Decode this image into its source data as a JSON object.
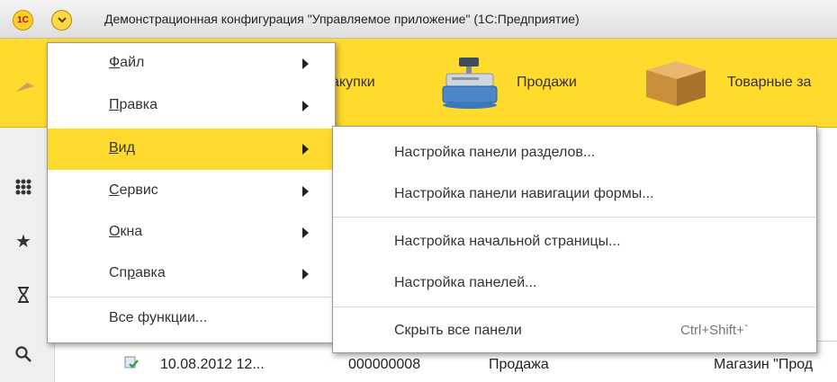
{
  "window": {
    "title": "Демонстрационная конфигурация \"Управляемое приложение\"  (1С:Предприятие)",
    "logo_text": "1С"
  },
  "sections": [
    {
      "label": "акупки",
      "icon": "purchases-icon"
    },
    {
      "label": "Продажи",
      "icon": "cash-register-icon"
    },
    {
      "label": "Товарные за",
      "icon": "box-icon"
    }
  ],
  "sidebar": {
    "icons": [
      "grid-icon",
      "star-icon",
      "history-icon",
      "search-icon"
    ]
  },
  "main_menu": {
    "items": [
      {
        "first": "Ф",
        "rest": "айл",
        "has_submenu": true
      },
      {
        "first": "П",
        "rest": "равка",
        "has_submenu": true
      },
      {
        "first": "В",
        "rest": "ид",
        "has_submenu": true,
        "active": true
      },
      {
        "first": "С",
        "rest": "ервис",
        "has_submenu": true
      },
      {
        "first": "О",
        "rest": "кна",
        "has_submenu": true
      },
      {
        "pre": "Сп",
        "first": "р",
        "rest": "авка",
        "has_submenu": true
      }
    ],
    "all_functions": "Все функции..."
  },
  "sub_menu": {
    "items": [
      {
        "label": "Настройка панели разделов..."
      },
      {
        "label": "Настройка панели навигации формы..."
      },
      {
        "label": "Настройка начальной страницы..."
      },
      {
        "label": "Настройка панелей..."
      },
      {
        "label": "Скрыть все панели",
        "shortcut": "Ctrl+Shift+`"
      }
    ]
  },
  "table": {
    "row": {
      "date": "10.08.2012 12...",
      "number": "000000008",
      "operation": "Продажа",
      "store": "Магазин \"Прод"
    }
  },
  "colors": {
    "accent_yellow": "#ffda2e",
    "menu_border": "#9a9a9a"
  }
}
